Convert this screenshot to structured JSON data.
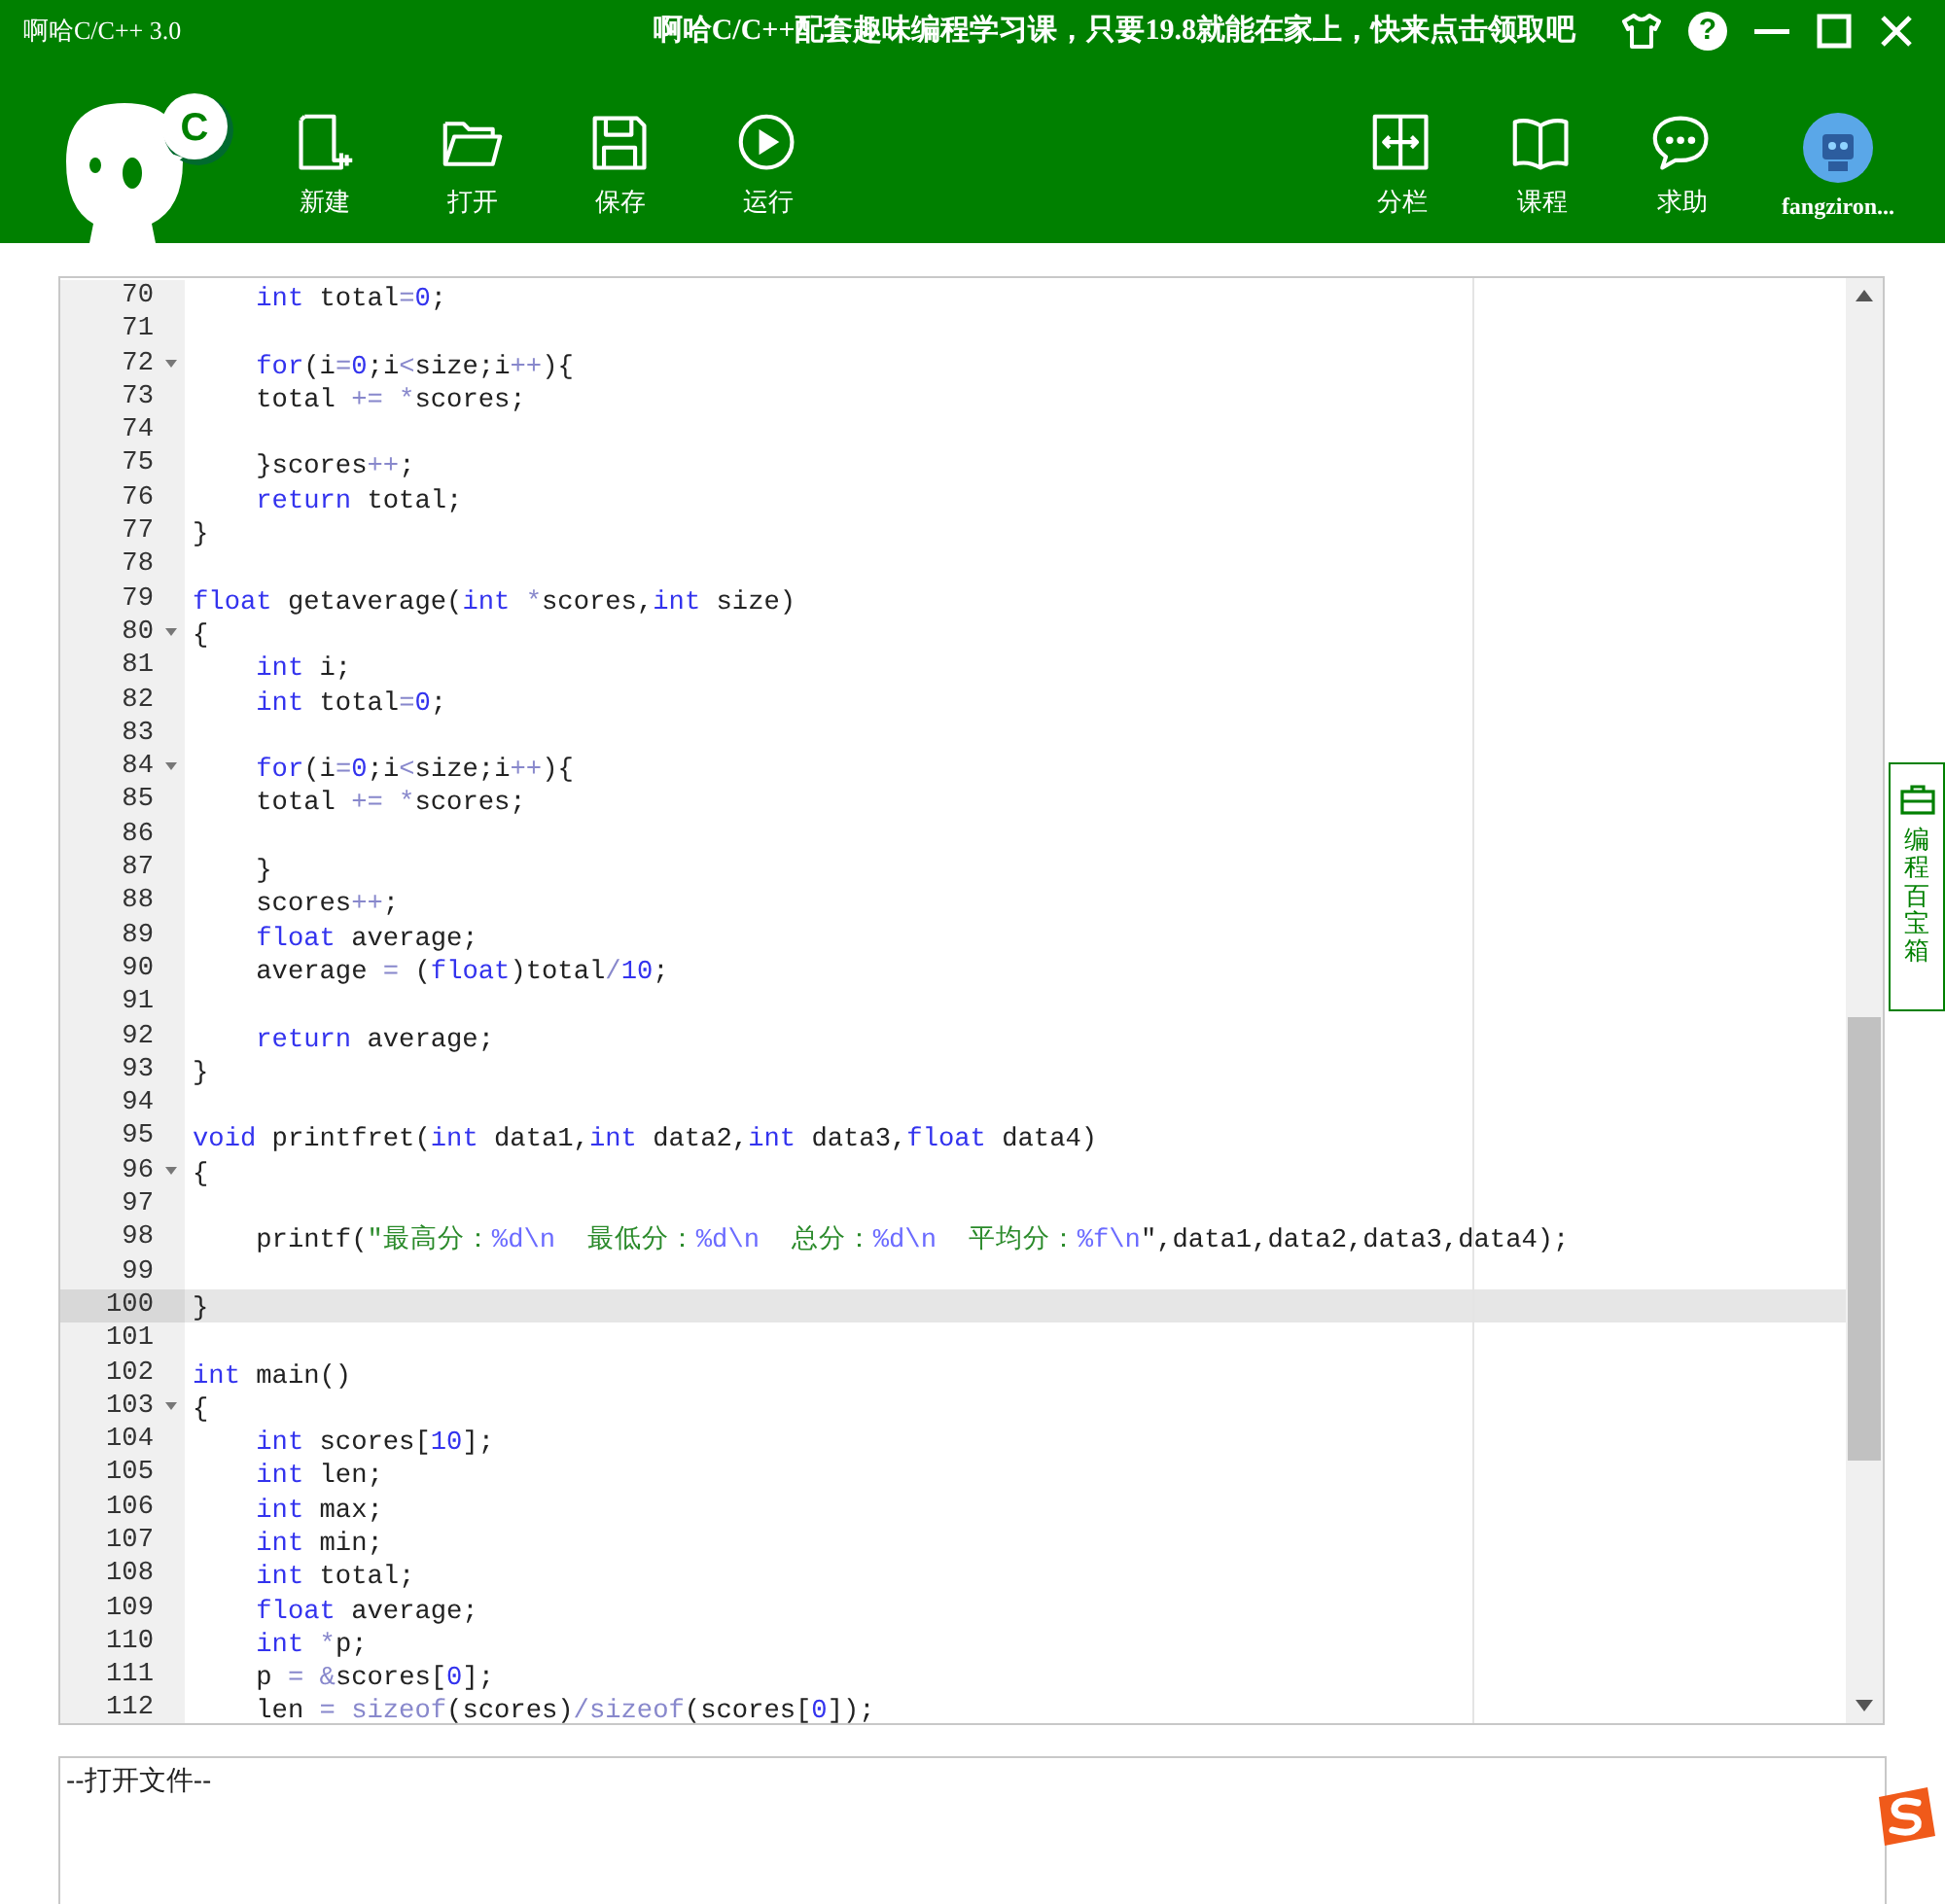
{
  "window": {
    "title": "啊哈C/C++ 3.0",
    "promo": "啊哈C/C++配套趣味编程学习课，只要19.8就能在家上，快来点击领取吧",
    "help_glyph": "?"
  },
  "logo": {
    "letter": "C"
  },
  "toolbar": {
    "left": [
      "新建",
      "打开",
      "保存",
      "运行"
    ],
    "right": [
      "分栏",
      "课程",
      "求助"
    ],
    "user": "fangziron..."
  },
  "editor": {
    "lines": [
      {
        "no": "70",
        "fold": false,
        "current": false,
        "tokens": [
          {
            "kind": "kw",
            "text": "    int"
          },
          {
            "kind": "p",
            "text": " total"
          },
          {
            "kind": "o",
            "text": "="
          },
          {
            "kind": "n",
            "text": "0"
          },
          {
            "kind": "p",
            "text": ";"
          }
        ]
      },
      {
        "no": "71",
        "fold": false,
        "current": false
      },
      {
        "no": "72",
        "fold": true,
        "current": false,
        "tokens": [
          {
            "kind": "kw",
            "text": "    for"
          },
          {
            "kind": "p",
            "text": "(i"
          },
          {
            "kind": "o",
            "text": "="
          },
          {
            "kind": "n",
            "text": "0"
          },
          {
            "kind": "p",
            "text": ";i"
          },
          {
            "kind": "o",
            "text": "<"
          },
          {
            "kind": "p",
            "text": "size;i"
          },
          {
            "kind": "o",
            "text": "++"
          },
          {
            "kind": "p",
            "text": "){"
          }
        ]
      },
      {
        "no": "73",
        "fold": false,
        "current": false,
        "tokens": [
          {
            "kind": "p",
            "text": "    total "
          },
          {
            "kind": "o",
            "text": "+= *"
          },
          {
            "kind": "p",
            "text": "scores;"
          }
        ]
      },
      {
        "no": "74",
        "fold": false,
        "current": false
      },
      {
        "no": "75",
        "fold": false,
        "current": false,
        "tokens": [
          {
            "kind": "p",
            "text": "    }scores"
          },
          {
            "kind": "o",
            "text": "++"
          },
          {
            "kind": "p",
            "text": ";"
          }
        ]
      },
      {
        "no": "76",
        "fold": false,
        "current": false,
        "tokens": [
          {
            "kind": "kw",
            "text": "    return"
          },
          {
            "kind": "p",
            "text": " total;"
          }
        ]
      },
      {
        "no": "77",
        "fold": false,
        "current": false,
        "tokens": [
          {
            "kind": "p",
            "text": "}"
          }
        ]
      },
      {
        "no": "78",
        "fold": false,
        "current": false
      },
      {
        "no": "79",
        "fold": false,
        "current": false,
        "tokens": [
          {
            "kind": "kw",
            "text": "float"
          },
          {
            "kind": "p",
            "text": " getaverage("
          },
          {
            "kind": "kw",
            "text": "int"
          },
          {
            "kind": "o",
            "text": " *"
          },
          {
            "kind": "p",
            "text": "scores,"
          },
          {
            "kind": "kw",
            "text": "int"
          },
          {
            "kind": "p",
            "text": " size)"
          }
        ]
      },
      {
        "no": "80",
        "fold": true,
        "current": false,
        "tokens": [
          {
            "kind": "p",
            "text": "{"
          }
        ]
      },
      {
        "no": "81",
        "fold": false,
        "current": false,
        "tokens": [
          {
            "kind": "kw",
            "text": "    int"
          },
          {
            "kind": "p",
            "text": " i;"
          }
        ]
      },
      {
        "no": "82",
        "fold": false,
        "current": false,
        "tokens": [
          {
            "kind": "kw",
            "text": "    int"
          },
          {
            "kind": "p",
            "text": " total"
          },
          {
            "kind": "o",
            "text": "="
          },
          {
            "kind": "n",
            "text": "0"
          },
          {
            "kind": "p",
            "text": ";"
          }
        ]
      },
      {
        "no": "83",
        "fold": false,
        "current": false
      },
      {
        "no": "84",
        "fold": true,
        "current": false,
        "tokens": [
          {
            "kind": "kw",
            "text": "    for"
          },
          {
            "kind": "p",
            "text": "(i"
          },
          {
            "kind": "o",
            "text": "="
          },
          {
            "kind": "n",
            "text": "0"
          },
          {
            "kind": "p",
            "text": ";i"
          },
          {
            "kind": "o",
            "text": "<"
          },
          {
            "kind": "p",
            "text": "size;i"
          },
          {
            "kind": "o",
            "text": "++"
          },
          {
            "kind": "p",
            "text": "){"
          }
        ]
      },
      {
        "no": "85",
        "fold": false,
        "current": false,
        "tokens": [
          {
            "kind": "p",
            "text": "    total "
          },
          {
            "kind": "o",
            "text": "+= *"
          },
          {
            "kind": "p",
            "text": "scores;"
          }
        ]
      },
      {
        "no": "86",
        "fold": false,
        "current": false
      },
      {
        "no": "87",
        "fold": false,
        "current": false,
        "tokens": [
          {
            "kind": "p",
            "text": "    }"
          }
        ]
      },
      {
        "no": "88",
        "fold": false,
        "current": false,
        "tokens": [
          {
            "kind": "p",
            "text": "    scores"
          },
          {
            "kind": "o",
            "text": "++"
          },
          {
            "kind": "p",
            "text": ";"
          }
        ]
      },
      {
        "no": "89",
        "fold": false,
        "current": false,
        "tokens": [
          {
            "kind": "kw",
            "text": "    float"
          },
          {
            "kind": "p",
            "text": " average;"
          }
        ]
      },
      {
        "no": "90",
        "fold": false,
        "current": false,
        "tokens": [
          {
            "kind": "p",
            "text": "    average "
          },
          {
            "kind": "o",
            "text": "="
          },
          {
            "kind": "p",
            "text": " ("
          },
          {
            "kind": "kw",
            "text": "float"
          },
          {
            "kind": "p",
            "text": ")total"
          },
          {
            "kind": "o",
            "text": "/"
          },
          {
            "kind": "n",
            "text": "10"
          },
          {
            "kind": "p",
            "text": ";"
          }
        ]
      },
      {
        "no": "91",
        "fold": false,
        "current": false
      },
      {
        "no": "92",
        "fold": false,
        "current": false,
        "tokens": [
          {
            "kind": "kw",
            "text": "    return"
          },
          {
            "kind": "p",
            "text": " average;"
          }
        ]
      },
      {
        "no": "93",
        "fold": false,
        "current": false,
        "tokens": [
          {
            "kind": "p",
            "text": "}"
          }
        ]
      },
      {
        "no": "94",
        "fold": false,
        "current": false
      },
      {
        "no": "95",
        "fold": false,
        "current": false,
        "tokens": [
          {
            "kind": "kw",
            "text": "void"
          },
          {
            "kind": "p",
            "text": " printfret("
          },
          {
            "kind": "kw",
            "text": "int"
          },
          {
            "kind": "p",
            "text": " data1,"
          },
          {
            "kind": "kw",
            "text": "int"
          },
          {
            "kind": "p",
            "text": " data2,"
          },
          {
            "kind": "kw",
            "text": "int"
          },
          {
            "kind": "p",
            "text": " data3,"
          },
          {
            "kind": "kw",
            "text": "float"
          },
          {
            "kind": "p",
            "text": " data4)"
          }
        ]
      },
      {
        "no": "96",
        "fold": true,
        "current": false,
        "tokens": [
          {
            "kind": "p",
            "text": "{"
          }
        ]
      },
      {
        "no": "97",
        "fold": false,
        "current": false
      },
      {
        "no": "98",
        "fold": false,
        "current": false,
        "tokens": [
          {
            "kind": "p",
            "text": "    printf("
          },
          {
            "kind": "s",
            "text": "\"最高分："
          },
          {
            "kind": "f",
            "text": "%d\\n"
          },
          {
            "kind": "s",
            "text": "  最低分："
          },
          {
            "kind": "f",
            "text": "%d\\n"
          },
          {
            "kind": "s",
            "text": "  总分："
          },
          {
            "kind": "f",
            "text": "%d\\n"
          },
          {
            "kind": "s",
            "text": "  平均分："
          },
          {
            "kind": "f",
            "text": "%f\\n"
          },
          {
            "kind": "p",
            "text": "\",data1,data2,data3,data4);"
          }
        ]
      },
      {
        "no": "99",
        "fold": false,
        "current": false
      },
      {
        "no": "100",
        "fold": false,
        "current": true,
        "tokens": [
          {
            "kind": "p",
            "text": "}"
          }
        ]
      },
      {
        "no": "101",
        "fold": false,
        "current": false
      },
      {
        "no": "102",
        "fold": false,
        "current": false,
        "tokens": [
          {
            "kind": "kw",
            "text": "int"
          },
          {
            "kind": "p",
            "text": " main()"
          }
        ]
      },
      {
        "no": "103",
        "fold": true,
        "current": false,
        "tokens": [
          {
            "kind": "p",
            "text": "{"
          }
        ]
      },
      {
        "no": "104",
        "fold": false,
        "current": false,
        "tokens": [
          {
            "kind": "kw",
            "text": "    int"
          },
          {
            "kind": "p",
            "text": " scores["
          },
          {
            "kind": "n",
            "text": "10"
          },
          {
            "kind": "p",
            "text": "];"
          }
        ]
      },
      {
        "no": "105",
        "fold": false,
        "current": false,
        "tokens": [
          {
            "kind": "kw",
            "text": "    int"
          },
          {
            "kind": "p",
            "text": " len;"
          }
        ]
      },
      {
        "no": "106",
        "fold": false,
        "current": false,
        "tokens": [
          {
            "kind": "kw",
            "text": "    int"
          },
          {
            "kind": "p",
            "text": " max;"
          }
        ]
      },
      {
        "no": "107",
        "fold": false,
        "current": false,
        "tokens": [
          {
            "kind": "kw",
            "text": "    int"
          },
          {
            "kind": "p",
            "text": " min;"
          }
        ]
      },
      {
        "no": "108",
        "fold": false,
        "current": false,
        "tokens": [
          {
            "kind": "kw",
            "text": "    int"
          },
          {
            "kind": "p",
            "text": " total;"
          }
        ]
      },
      {
        "no": "109",
        "fold": false,
        "current": false,
        "tokens": [
          {
            "kind": "kw",
            "text": "    float"
          },
          {
            "kind": "p",
            "text": " average;"
          }
        ]
      },
      {
        "no": "110",
        "fold": false,
        "current": false,
        "tokens": [
          {
            "kind": "kw",
            "text": "    int"
          },
          {
            "kind": "o",
            "text": " *"
          },
          {
            "kind": "p",
            "text": "p;"
          }
        ]
      },
      {
        "no": "111",
        "fold": false,
        "current": false,
        "tokens": [
          {
            "kind": "p",
            "text": "    p "
          },
          {
            "kind": "o",
            "text": "= &"
          },
          {
            "kind": "p",
            "text": "scores["
          },
          {
            "kind": "n",
            "text": "0"
          },
          {
            "kind": "p",
            "text": "];"
          }
        ]
      },
      {
        "no": "112",
        "fold": false,
        "current": false,
        "tokens": [
          {
            "kind": "p",
            "text": "    len "
          },
          {
            "kind": "o",
            "text": "= sizeof"
          },
          {
            "kind": "p",
            "text": "(scores)"
          },
          {
            "kind": "o",
            "text": "/sizeof"
          },
          {
            "kind": "p",
            "text": "(scores["
          },
          {
            "kind": "n",
            "text": "0"
          },
          {
            "kind": "p",
            "text": "]);"
          }
        ]
      }
    ]
  },
  "side_tab": "编程百宝箱",
  "output": {
    "text": "--打开文件--"
  }
}
